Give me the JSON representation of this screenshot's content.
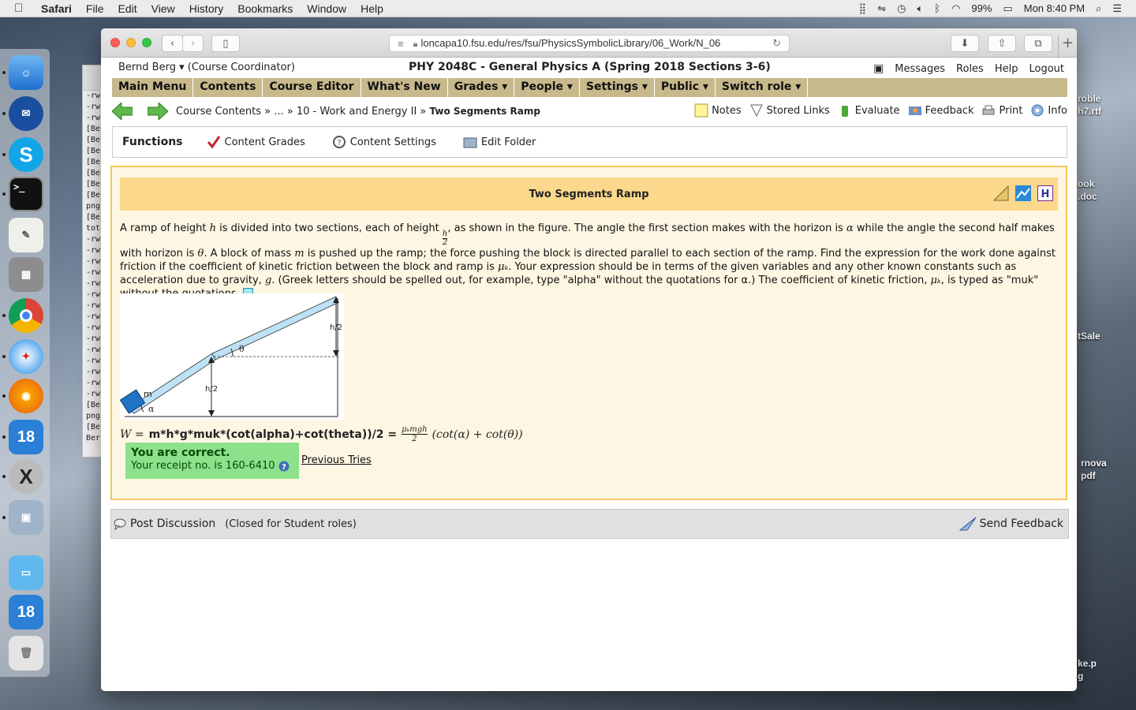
{
  "menubar": {
    "app": "Safari",
    "items": [
      "File",
      "Edit",
      "View",
      "History",
      "Bookmarks",
      "Window",
      "Help"
    ],
    "battery": "99%",
    "clock": "Mon 8:40 PM"
  },
  "desktop": {
    "labels": [
      "roble",
      "h7.rtf",
      "ook",
      ".doc",
      "tSale",
      "rnova",
      "pdf",
      "ke.p",
      "g"
    ]
  },
  "dock": {
    "badge_a": "18",
    "badge_b": "18"
  },
  "terminal": {
    "lines": [
      "-rw",
      "-rw",
      "-rw",
      "[Ber",
      "[Ber",
      "[Ber",
      "[Ber",
      "[Ber",
      "[Ber",
      "[Ber",
      "png",
      "[Ber",
      "tot",
      "-rw",
      "-rw",
      "-rw",
      "-rw",
      "-rw",
      "-rw",
      "-rw",
      "-rw",
      "-rw",
      "-rw",
      "-rw",
      "-rw",
      "-rw",
      "-rw",
      "-rw",
      "[Ber",
      "png",
      "[Ber",
      "Ber"
    ]
  },
  "browser": {
    "url": "loncapa10.fsu.edu/res/fsu/PhysicsSymbolicLibrary/06_Work/N_06"
  },
  "userbar": {
    "user": "Bernd Berg ▾",
    "role": "(Course Coordinator)",
    "course": "PHY 2048C - General Physics A (Spring 2018 Sections 3-6)",
    "links": [
      "Messages",
      "Roles",
      "Help",
      "Logout"
    ]
  },
  "mainnav": [
    "Main Menu",
    "Contents",
    "Course Editor",
    "What's New",
    "Grades ▾",
    "People ▾",
    "Settings ▾",
    "Public ▾",
    "Switch role ▾"
  ],
  "crumbs": {
    "path": "Course Contents » ... » 10 - Work and Energy II »",
    "current": "Two Segments Ramp"
  },
  "tools": {
    "notes": "Notes",
    "stored_links": "Stored Links",
    "evaluate": "Evaluate",
    "feedback": "Feedback",
    "print": "Print",
    "info": "Info"
  },
  "functions": {
    "title": "Functions",
    "content_grades": "Content Grades",
    "content_settings": "Content Settings",
    "edit_folder": "Edit Folder"
  },
  "problem": {
    "title": "Two Segments Ramp",
    "text1": "A ramp of height ",
    "text2": " is divided into two sections, each of height ",
    "text3": ", as shown in the figure. The angle the first section makes with the horizon is ",
    "text4": " while the angle the second half makes with horizon is ",
    "text5": ". A block of mass ",
    "text6": " is pushed up the ramp; the force pushing the block is directed parallel to each section of the ramp. Find the expression for the work done against friction if the coefficient of kinetic friction between the block and ramp is ",
    "text7": ". Your expression should be in terms of the given variables and any other known constants such as acceleration due to gravity, ",
    "text8": ". (Greek letters should be spelled out, for example, type \"alpha\" without the quotations for α.) The coefficient of kinetic friction, ",
    "text9": ", is typed as \"muk\" without the quotations.",
    "sym_h": "h",
    "sym_half_num": "h",
    "sym_half_den": "2",
    "sym_alpha": "α",
    "sym_theta": "θ",
    "sym_m": "m",
    "sym_muk": "μₖ",
    "sym_g": "g",
    "figure": {
      "label_m": "m",
      "label_alpha": "α",
      "label_theta": "θ",
      "label_h2_top": "h/2",
      "label_h2_bottom": "h/2"
    },
    "answer_prefix": "W =",
    "answer_input": "m*h*g*muk*(cot(alpha)+cot(theta))/2 =",
    "answer_frac_num": "μₖmgh",
    "answer_frac_den": "2",
    "answer_rest": "(cot(α) + cot(θ))",
    "correct_title": "You are correct.",
    "receipt": "Your receipt no. is 160-6410",
    "previous_tries": "Previous Tries"
  },
  "discussion": {
    "post": "Post Discussion",
    "closed": "(Closed for Student roles)",
    "send_feedback": "Send Feedback"
  },
  "colors": {
    "nav_bg": "#c8b98c",
    "title_bg": "#fbd88b",
    "problem_border": "#f1c95a",
    "correct_bg": "#8de18a"
  }
}
